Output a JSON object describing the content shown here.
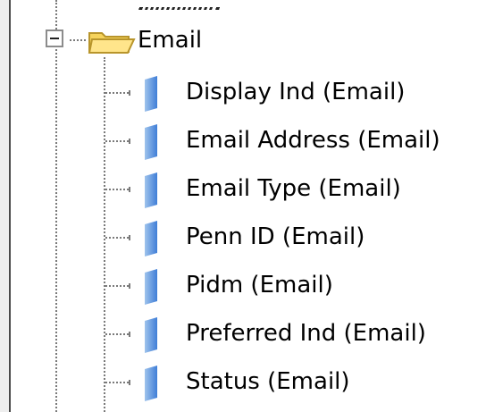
{
  "tree": {
    "root": {
      "label": "Email",
      "expanded": true,
      "expander_icon": "minus-box-icon",
      "icon": "open-folder-icon"
    },
    "children": [
      {
        "label": "Display Ind (Email)",
        "icon": "field-icon"
      },
      {
        "label": "Email Address (Email)",
        "icon": "field-icon"
      },
      {
        "label": "Email Type (Email)",
        "icon": "field-icon"
      },
      {
        "label": "Penn ID (Email)",
        "icon": "field-icon"
      },
      {
        "label": "Pidm (Email)",
        "icon": "field-icon"
      },
      {
        "label": "Preferred Ind (Email)",
        "icon": "field-icon"
      },
      {
        "label": "Status (Email)",
        "icon": "field-icon"
      }
    ]
  },
  "colors": {
    "folder_fill": "#f6d35b",
    "folder_stroke": "#b8952b",
    "field_icon_light": "#9fc3ec",
    "field_icon_dark": "#3f7ed7",
    "connector": "#7a7a7a"
  }
}
